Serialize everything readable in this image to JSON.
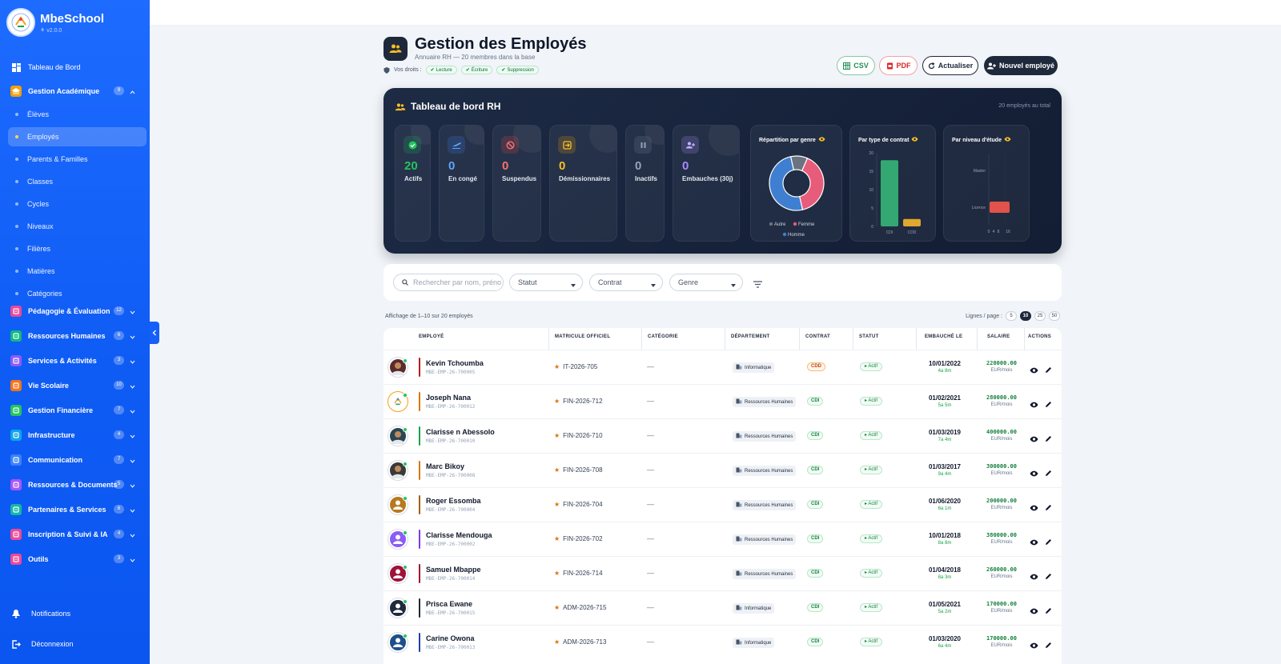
{
  "app": {
    "name": "MbeSchool",
    "version": "v2.0.0"
  },
  "sidebar": {
    "dashboard": "Tableau de Bord",
    "academic": {
      "label": "Gestion Académique",
      "badge": "9",
      "items": [
        "Élèves",
        "Employés",
        "Parents & Familles",
        "Classes",
        "Cycles",
        "Niveaux",
        "Filières",
        "Matières",
        "Catégories"
      ],
      "active_index": 1
    },
    "groups": [
      {
        "label": "Pédagogie & Évaluation",
        "badge": "12",
        "color": "#ec4899",
        "icon": "clipboard-icon"
      },
      {
        "label": "Ressources Humaines",
        "badge": "6",
        "color": "#10b981",
        "icon": "briefcase-icon"
      },
      {
        "label": "Services & Activités",
        "badge": "3",
        "color": "#8b5cf6",
        "icon": "palette-icon"
      },
      {
        "label": "Vie Scolaire",
        "badge": "10",
        "color": "#f97316",
        "icon": "running-icon"
      },
      {
        "label": "Gestion Financière",
        "badge": "7",
        "color": "#22c55e",
        "icon": "money-icon"
      },
      {
        "label": "Infrastructure",
        "badge": "4",
        "color": "#0ea5e9",
        "icon": "building-icon"
      },
      {
        "label": "Communication",
        "badge": "7",
        "color": "#3b82f6",
        "icon": "mail-icon"
      },
      {
        "label": "Ressources & Documents",
        "badge": "5",
        "color": "#a855f7",
        "icon": "folder-icon"
      },
      {
        "label": "Partenaires & Services",
        "badge": "6",
        "color": "#14b8a6",
        "icon": "handshake-icon"
      },
      {
        "label": "Inscription & Suivi & IA",
        "badge": "4",
        "color": "#ec4899",
        "icon": "form-icon"
      },
      {
        "label": "Outils",
        "badge": "3",
        "color": "#ec4899",
        "icon": "gear-icon"
      }
    ],
    "notifications": "Notifications",
    "logout": "Déconnexion"
  },
  "header": {
    "title": "Gestion des Employés",
    "subtitle": "Annuaire RH — 20 membres dans la base",
    "rights_label": "Vos droits :",
    "rights": [
      "Lecture",
      "Écriture",
      "Suppression"
    ],
    "buttons": {
      "csv": "CSV",
      "pdf": "PDF",
      "refresh": "Actualiser",
      "new": "Nouvel employé"
    }
  },
  "dashboard": {
    "title": "Tableau de bord RH",
    "total": "20 employés au total",
    "kpis": [
      {
        "value": "20",
        "label": "Actifs",
        "color": "#22c55e",
        "icon": "check-circle-icon"
      },
      {
        "value": "0",
        "label": "En congé",
        "color": "#3b82f6",
        "icon": "plane-icon"
      },
      {
        "value": "0",
        "label": "Suspendus",
        "color": "#ef4444",
        "icon": "ban-icon"
      },
      {
        "value": "0",
        "label": "Démissionnaires",
        "color": "#f59e0b",
        "icon": "exit-icon"
      },
      {
        "value": "0",
        "label": "Inactifs",
        "color": "#64748b",
        "icon": "pause-icon"
      },
      {
        "value": "0",
        "label": "Embauches (30j)",
        "color": "#a78bfa",
        "icon": "user-plus-icon"
      }
    ],
    "charts": {
      "gender_title": "Répartition par genre",
      "contract_title": "Par type de contrat",
      "level_title": "Par niveau d'étude"
    }
  },
  "chart_data": [
    {
      "type": "pie",
      "title": "Répartition par genre",
      "categories": [
        "Autre",
        "Femme",
        "Homme"
      ],
      "values": [
        2,
        8,
        10
      ],
      "colors": [
        "#6b7280",
        "#e75b7b",
        "#3f7fd1"
      ]
    },
    {
      "type": "bar",
      "title": "Par type de contrat",
      "categories": [
        "CDI",
        "CDD"
      ],
      "values": [
        18,
        2
      ],
      "ylim": [
        0,
        20
      ],
      "yticks": [
        0,
        5,
        10,
        15,
        20
      ],
      "colors": [
        "#34a872",
        "#e0a82e"
      ]
    },
    {
      "type": "bar",
      "orientation": "horizontal",
      "title": "Par niveau d'étude",
      "categories": [
        "Master",
        "Licence"
      ],
      "values": [
        0,
        20
      ],
      "xlim": [
        0,
        16
      ],
      "xticks": [
        0,
        4,
        8,
        16
      ],
      "colors": [
        "#3f7fd1",
        "#e0524a"
      ]
    }
  ],
  "filters": {
    "search_placeholder": "Rechercher par nom, prénom",
    "statut": "Statut",
    "contrat": "Contrat",
    "genre": "Genre"
  },
  "table": {
    "count_text": "Affichage de 1–10 sur 20 employés",
    "per_page_label": "Lignes / page :",
    "per_page_options": [
      "5",
      "10",
      "25",
      "50"
    ],
    "per_page_active": 1,
    "headers": [
      "EMPLOYÉ",
      "MATRICULE OFFICIEL",
      "CATÉGORIE",
      "DÉPARTEMENT",
      "CONTRAT",
      "STATUT",
      "EMBAUCHÉ LE",
      "SALAIRE",
      "ACTIONS"
    ],
    "rows": [
      {
        "name": "Kevin Tchoumba",
        "code": "MBE-EMP-26-700005",
        "matricule": "IT-2026-705",
        "categorie": "—",
        "departement": "Informatique",
        "contrat": "CDD",
        "statut": "Actif",
        "date": "10/01/2022",
        "since": "4a 8m",
        "salaire": "220000.00",
        "unit": "EUR/mois",
        "bar": "#b91c1c",
        "avatar": "#5b2b2b",
        "avatar_kind": "photo"
      },
      {
        "name": "Joseph Nana",
        "code": "MBE-EMP-26-700012",
        "matricule": "FIN-2026-712",
        "categorie": "—",
        "departement": "Ressources Humaines",
        "contrat": "CDI",
        "statut": "Actif",
        "date": "01/02/2021",
        "since": "5a 5m",
        "salaire": "280000.00",
        "unit": "EUR/mois",
        "bar": "#d97706",
        "avatar": "#ffffff",
        "avatar_kind": "logo"
      },
      {
        "name": "Clarisse n Abessolo",
        "code": "MBE-EMP-26-700010",
        "matricule": "FIN-2026-710",
        "categorie": "—",
        "departement": "Ressources Humaines",
        "contrat": "CDI",
        "statut": "Actif",
        "date": "01/03/2019",
        "since": "7a 4m",
        "salaire": "400000.00",
        "unit": "EUR/mois",
        "bar": "#16a34a",
        "avatar": "#2a4656",
        "avatar_kind": "photo"
      },
      {
        "name": "Marc Bikoy",
        "code": "MBE-EMP-26-700008",
        "matricule": "FIN-2026-708",
        "categorie": "—",
        "departement": "Ressources Humaines",
        "contrat": "CDI",
        "statut": "Actif",
        "date": "01/03/2017",
        "since": "9a 4m",
        "salaire": "300000.00",
        "unit": "EUR/mois",
        "bar": "#d97706",
        "avatar": "#3a3a3a",
        "avatar_kind": "photo"
      },
      {
        "name": "Roger Essomba",
        "code": "MBE-EMP-26-700004",
        "matricule": "FIN-2026-704",
        "categorie": "—",
        "departement": "Ressources Humaines",
        "contrat": "CDI",
        "statut": "Actif",
        "date": "01/06/2020",
        "since": "6a 1m",
        "salaire": "200000.00",
        "unit": "EUR/mois",
        "bar": "#a16207",
        "avatar": "#b7791f",
        "avatar_kind": "icon"
      },
      {
        "name": "Clarisse Mendouga",
        "code": "MBE-EMP-26-700002",
        "matricule": "FIN-2026-702",
        "categorie": "—",
        "departement": "Ressources Humaines",
        "contrat": "CDI",
        "statut": "Actif",
        "date": "10/01/2018",
        "since": "8a 8m",
        "salaire": "380000.00",
        "unit": "EUR/mois",
        "bar": "#7c3aed",
        "avatar": "#8b5cf6",
        "avatar_kind": "icon"
      },
      {
        "name": "Samuel Mbappe",
        "code": "MBE-EMP-26-700014",
        "matricule": "FIN-2026-714",
        "categorie": "—",
        "departement": "Ressources Humaines",
        "contrat": "CDI",
        "statut": "Actif",
        "date": "01/04/2018",
        "since": "8a 3m",
        "salaire": "260000.00",
        "unit": "EUR/mois",
        "bar": "#9f1239",
        "avatar": "#9f1239",
        "avatar_kind": "icon"
      },
      {
        "name": "Prisca Ewane",
        "code": "MBE-EMP-26-700015",
        "matricule": "ADM-2026-715",
        "categorie": "—",
        "departement": "Informatique",
        "contrat": "CDI",
        "statut": "Actif",
        "date": "01/05/2021",
        "since": "5a 2m",
        "salaire": "170000.00",
        "unit": "EUR/mois",
        "bar": "#1e293b",
        "avatar": "#1e293b",
        "avatar_kind": "icon"
      },
      {
        "name": "Carine Owona",
        "code": "MBE-EMP-26-700013",
        "matricule": "ADM-2026-713",
        "categorie": "—",
        "departement": "Informatique",
        "contrat": "CDI",
        "statut": "Actif",
        "date": "01/03/2020",
        "since": "6a 4m",
        "salaire": "170000.00",
        "unit": "EUR/mois",
        "bar": "#1e40af",
        "avatar": "#1e4f8a",
        "avatar_kind": "icon"
      }
    ]
  }
}
